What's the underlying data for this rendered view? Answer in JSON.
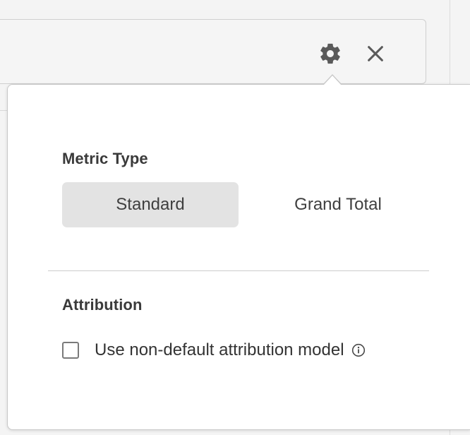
{
  "toolbar": {
    "gear_icon": "gear-icon",
    "close_icon": "close-icon"
  },
  "popover": {
    "metric_type": {
      "title": "Metric Type",
      "options": [
        {
          "label": "Standard",
          "selected": true
        },
        {
          "label": "Grand Total",
          "selected": false
        }
      ]
    },
    "attribution": {
      "title": "Attribution",
      "checkbox_label": "Use non-default attribution model",
      "checked": false,
      "info_icon": "info-icon"
    }
  },
  "colors": {
    "selected_segment": "#e3e3e3",
    "icon": "#5a5a5a",
    "border": "#c8c8c8"
  }
}
